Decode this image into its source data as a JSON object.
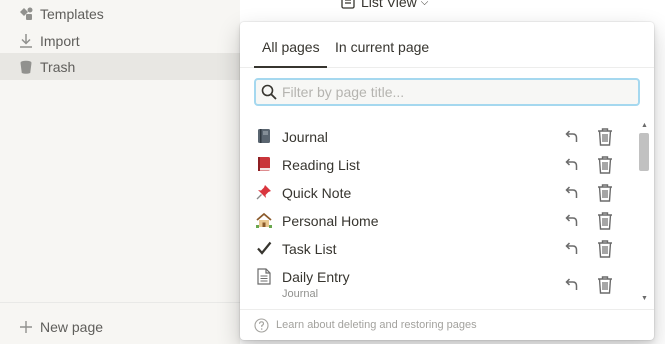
{
  "sidebar": {
    "templates": "Templates",
    "import": "Import",
    "trash": "Trash",
    "new_page": "New page"
  },
  "header": {
    "view_label": "List View"
  },
  "popup": {
    "tabs": [
      "All pages",
      "In current page"
    ],
    "active_tab": "All pages",
    "search": {
      "placeholder": "Filter by page title...",
      "value": ""
    },
    "items": [
      {
        "icon": "notebook-icon",
        "title": "Journal",
        "subtitle": ""
      },
      {
        "icon": "red-book-icon",
        "title": "Reading List",
        "subtitle": ""
      },
      {
        "icon": "pushpin-icon",
        "title": "Quick Note",
        "subtitle": ""
      },
      {
        "icon": "house-icon",
        "title": "Personal Home",
        "subtitle": ""
      },
      {
        "icon": "checkmark-icon",
        "title": "Task List",
        "subtitle": ""
      },
      {
        "icon": "page-icon",
        "title": "Daily Entry",
        "subtitle": "Journal"
      }
    ],
    "footer": "Learn about deleting and restoring pages"
  },
  "colors": {
    "sidebar_bg": "#f7f6f3",
    "active_item_bg": "#e8e7e3",
    "search_focus_border": "#a5d8ef",
    "text": "#37352f",
    "muted_text": "#91918e"
  }
}
